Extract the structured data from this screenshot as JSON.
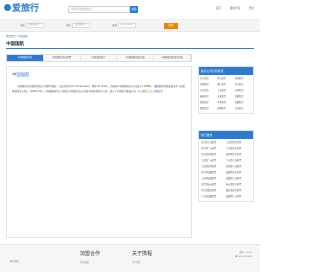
{
  "header": {
    "logo": "爱旅行",
    "search_placeholder": "搜索机场航线航班",
    "search_button": "搜索",
    "links": [
      "首页",
      "我的行程",
      "登录"
    ]
  },
  "flightbar": {
    "from_label": "出发",
    "from_value": "请选择城市",
    "to_label": "到达",
    "to_value": "请选择城市",
    "date_label": "日期",
    "date_value": "yyyy-mm-dd",
    "submit": "搜索"
  },
  "breadcrumb": "机票首页 > 中国国航",
  "page_title": "中国国航",
  "tabs": [
    "中国国航首页",
    "中国国航特价机票",
    "中国国航简介",
    "中国国航航班动态",
    "中国国航航班时刻表"
  ],
  "content": {
    "heading": "中国国航",
    "paragraph": "中国国际航空股份有限公司简称“国航”，英文名称为Air China Limited，简称“Air China”，其前身中国国际航空公司成立于1988年。根据国务院批准通过的《民航体制改革方案》，2002年10月，中国国际航空公司联合中国航空总公司和中国西南航空公司，成立了中国航空集团公司，并以联合三方",
    "more": "查看更多"
  },
  "side_special": {
    "title": "航空公司打折机票",
    "items": [
      "东方航空",
      "南方航空",
      "海南航空",
      "深圳航空",
      "厦门航空",
      "四川航空",
      "山东航空",
      "上海航空",
      "吉祥航空",
      "春秋航空",
      "天津航空",
      "首都航空",
      "西部航空",
      "华夏航空",
      "成都航空",
      "奥凯航空",
      "祥鹏航空",
      "长龙航空"
    ]
  },
  "side_hot": {
    "title": "热门航线",
    "items": [
      "北京到上海机票",
      "上海到北京机票",
      "北京到广州机票",
      "广州到北京机票",
      "北京到深圳机票",
      "深圳到北京机票",
      "上海到广州机票",
      "广州到上海机票",
      "上海到深圳机票",
      "深圳到上海机票",
      "北京到成都机票",
      "成都到北京机票",
      "上海到成都机票",
      "成都到上海机票",
      "北京到杭州机票",
      "杭州到北京机票",
      "北京到重庆机票",
      "重庆到北京机票",
      "广州到成都机票",
      "成都到广州机票"
    ]
  },
  "footer": {
    "col1_title": "加盟合作",
    "col1_sub": "合作加盟",
    "col2_title": "关于携程",
    "col2_sub": "关于我们",
    "col0_sub": "联系客服",
    "right_line1": "国内：95010",
    "right_line2": "☎ 400-000-0000"
  }
}
